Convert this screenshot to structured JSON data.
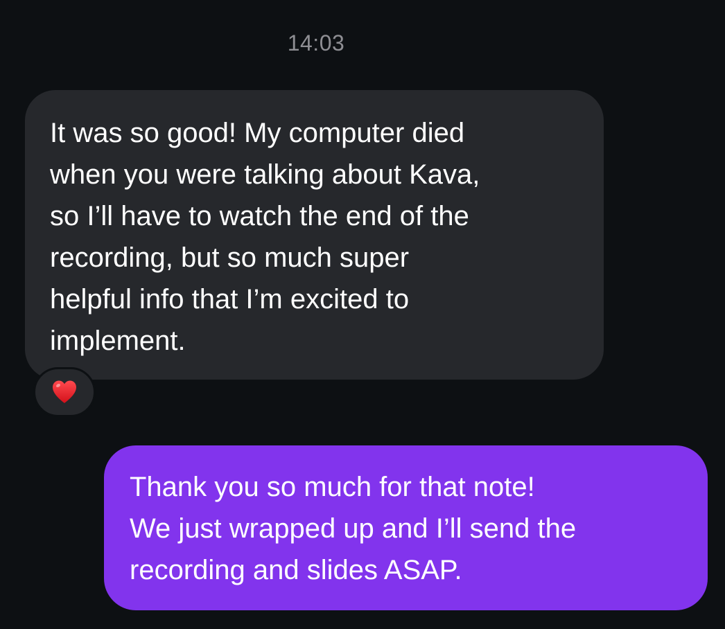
{
  "conversation": {
    "timestamp": "14:03",
    "messages": [
      {
        "direction": "incoming",
        "lines": [
          "It was so good! My computer died",
          "when you were talking about Kava,",
          "so I’ll have to watch the end of the",
          "recording, but so much super",
          "helpful info that I’m excited to",
          "implement."
        ],
        "reaction": {
          "icon": "red-heart-icon",
          "color": "#e21b22"
        }
      },
      {
        "direction": "outgoing",
        "lines": [
          "Thank you so much for that note!",
          "We just wrapped up and I’ll send the",
          "recording and slides ASAP."
        ]
      }
    ]
  },
  "colors": {
    "background": "#0d1013",
    "incoming_bubble": "#26282c",
    "outgoing_bubble": "#8234ed",
    "text": "#ffffff",
    "timestamp_text": "#8e8e93"
  }
}
